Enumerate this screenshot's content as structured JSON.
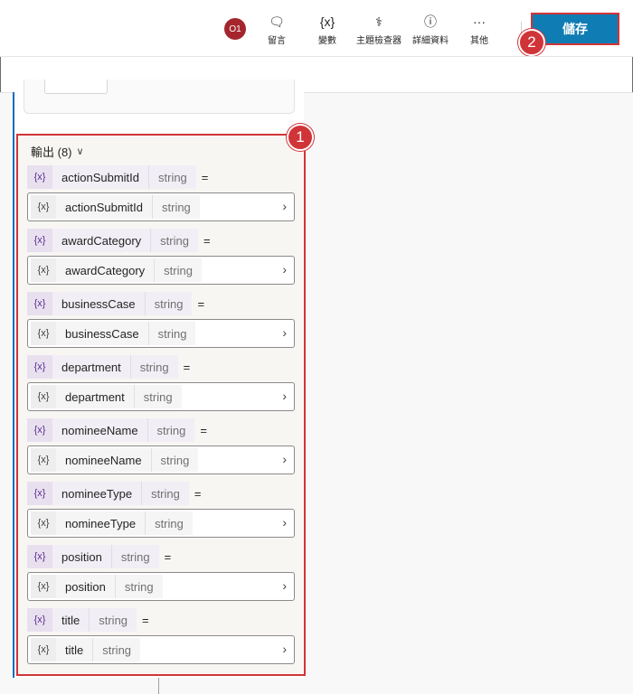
{
  "toolbar": {
    "avatar": "O1",
    "items": [
      {
        "label": "留言",
        "icon": "comment-icon",
        "glyph": "🗨"
      },
      {
        "label": "變數",
        "icon": "variable-icon",
        "glyph": "{x}"
      },
      {
        "label": "主題檢查器",
        "icon": "stethoscope-icon",
        "glyph": "⚕"
      },
      {
        "label": "詳細資料",
        "icon": "info-icon",
        "glyph": "ⓘ"
      },
      {
        "label": "其他",
        "icon": "more-icon",
        "glyph": "···"
      }
    ],
    "save_label": "儲存"
  },
  "callouts": {
    "one": "1",
    "two": "2"
  },
  "outputs": {
    "title": "輸出 (8)",
    "token": "{x}",
    "equals": "=",
    "arrow": "›",
    "variables": [
      {
        "name": "actionSubmitId",
        "type": "string",
        "value_name": "actionSubmitId",
        "value_type": "string"
      },
      {
        "name": "awardCategory",
        "type": "string",
        "value_name": "awardCategory",
        "value_type": "string"
      },
      {
        "name": "businessCase",
        "type": "string",
        "value_name": "businessCase",
        "value_type": "string"
      },
      {
        "name": "department",
        "type": "string",
        "value_name": "department",
        "value_type": "string"
      },
      {
        "name": "nomineeName",
        "type": "string",
        "value_name": "nomineeName",
        "value_type": "string"
      },
      {
        "name": "nomineeType",
        "type": "string",
        "value_name": "nomineeType",
        "value_type": "string"
      },
      {
        "name": "position",
        "type": "string",
        "value_name": "position",
        "value_type": "string"
      },
      {
        "name": "title",
        "type": "string",
        "value_name": "title",
        "value_type": "string"
      }
    ]
  },
  "colors": {
    "accent": "#0f7cb4",
    "highlight": "#d13438",
    "token": "#5c2e91"
  }
}
